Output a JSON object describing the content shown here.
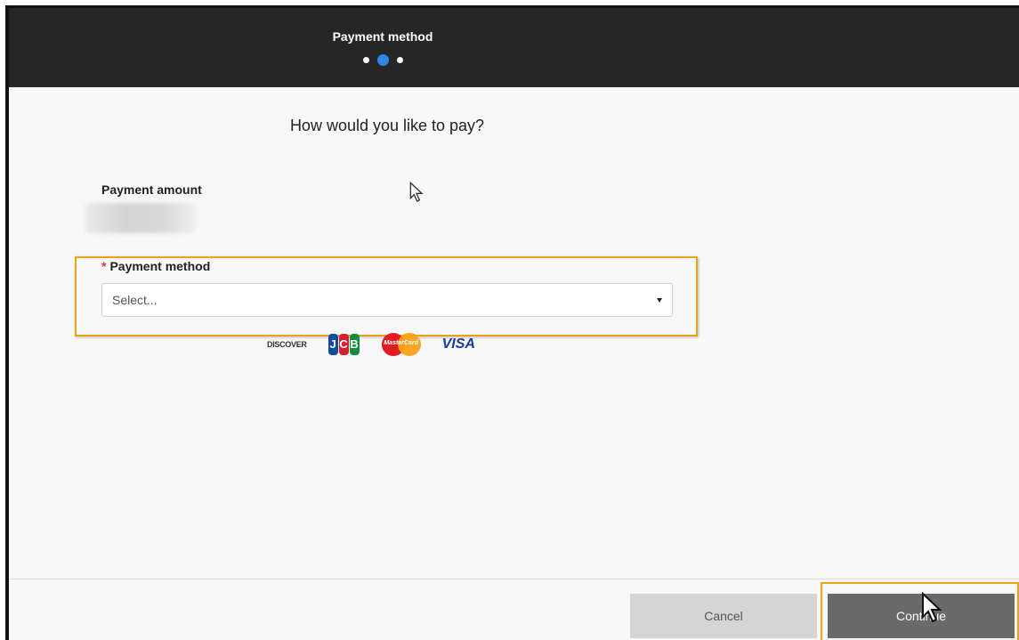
{
  "header": {
    "title": "Payment method",
    "steps": [
      {
        "state": "inactive"
      },
      {
        "state": "active"
      },
      {
        "state": "inactive"
      }
    ]
  },
  "main": {
    "question": "How would you like to pay?",
    "payment_amount": {
      "label": "Payment amount",
      "value_redacted": true
    },
    "payment_method": {
      "required_marker": "*",
      "label": "Payment method",
      "selected": "Select..."
    },
    "card_logos": {
      "discover": "DISCOVER",
      "jcb": [
        "J",
        "C",
        "B"
      ],
      "mastercard": "MasterCard",
      "visa": "VISA"
    }
  },
  "footer": {
    "cancel_label": "Cancel",
    "continue_label": "Continue"
  },
  "colors": {
    "header_bg": "#262626",
    "step_active": "#2e86e8",
    "highlight": "#e8a317",
    "required": "#dd3333",
    "continue_bg": "#6a6a6a",
    "cancel_bg": "#d5d5d5"
  }
}
